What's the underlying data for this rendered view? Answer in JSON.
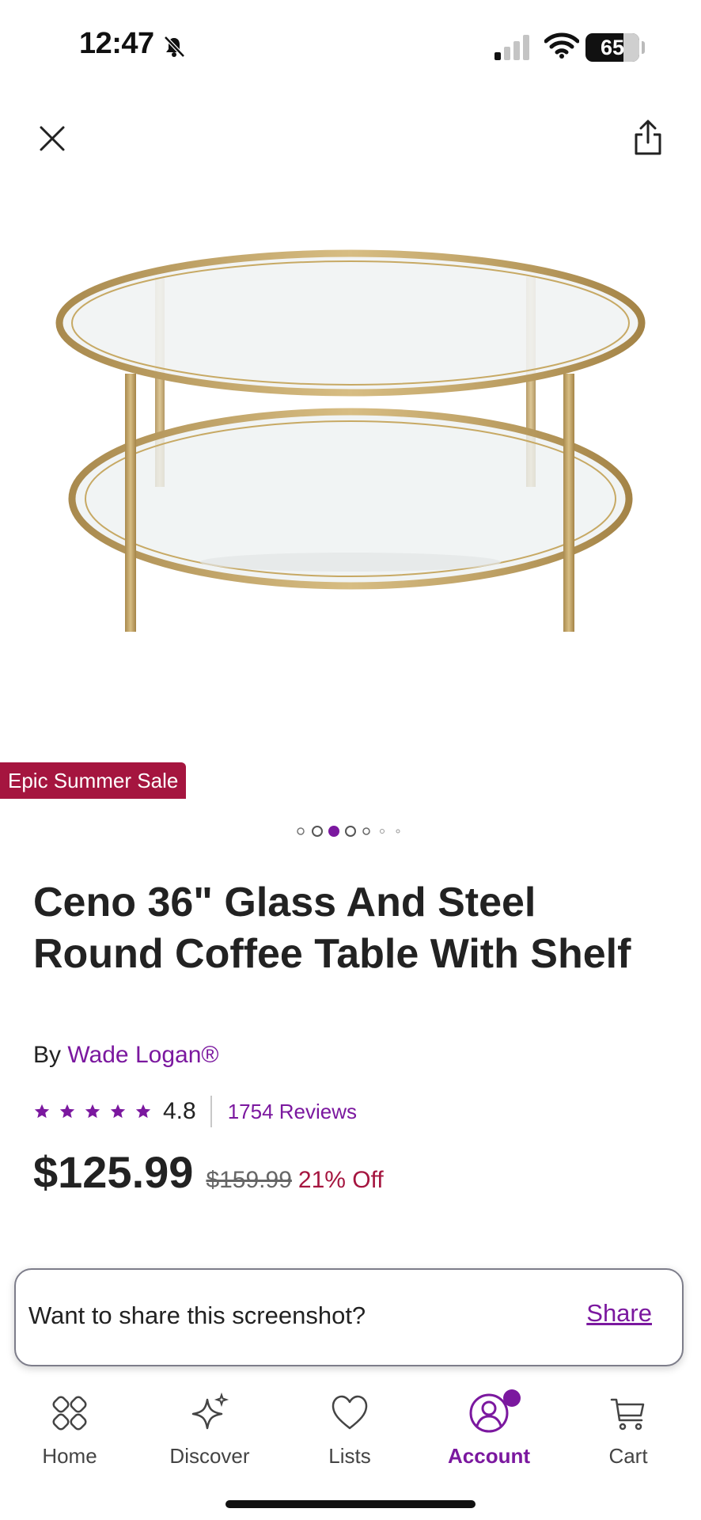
{
  "status_bar": {
    "time": "12:47",
    "battery": "65",
    "icons": [
      "bell-slash-icon",
      "cellular-signal-icon",
      "wifi-icon",
      "battery-icon"
    ]
  },
  "header": {
    "close_icon": "close-icon",
    "share_icon": "share-icon"
  },
  "product": {
    "image_alt_icon": "glass-coffee-table-image",
    "badge": "Epic Summer Sale",
    "carousel": {
      "count": 7,
      "active_index": 2
    },
    "title": "Ceno 36\" Glass And Steel Round Coffee Table With Shelf",
    "by_prefix": "By",
    "brand": "Wade Logan®",
    "rating": "4.8",
    "stars_filled": 5,
    "reviews": "1754 Reviews",
    "price": "$125.99",
    "original_price": "$159.99",
    "discount": "21% Off"
  },
  "share_prompt": {
    "text": "Want to share this screenshot?",
    "action": "Share"
  },
  "bottom_nav": {
    "items": [
      {
        "label": "Home",
        "icon": "home-icon"
      },
      {
        "label": "Discover",
        "icon": "sparkle-icon"
      },
      {
        "label": "Lists",
        "icon": "heart-icon"
      },
      {
        "label": "Account",
        "icon": "account-icon",
        "active": true
      },
      {
        "label": "Cart",
        "icon": "cart-icon"
      }
    ]
  },
  "colors": {
    "accent": "#7b189f",
    "sale": "#a5153f",
    "text": "#222222"
  }
}
